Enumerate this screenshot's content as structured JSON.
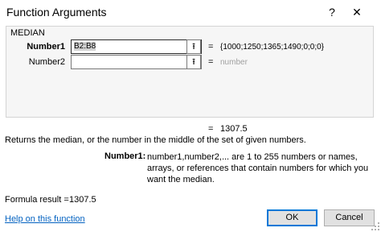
{
  "window": {
    "title": "Function Arguments",
    "help": "?",
    "close": "✕"
  },
  "function_name": "MEDIAN",
  "arguments": [
    {
      "label": "Number1",
      "value": "B2:B8",
      "collapse_icon": "⭱",
      "equals": "=",
      "evaluated": "{1000;1250;1365;1490;0;0;0}"
    },
    {
      "label": "Number2",
      "value": "",
      "collapse_icon": "⭱",
      "equals": "=",
      "evaluated": "number"
    }
  ],
  "result_preview": {
    "equals": "=",
    "value": "1307.5"
  },
  "description": "Returns the median, or the number in the middle of the set of given numbers.",
  "arg_help": {
    "label": "Number1:",
    "text": "number1,number2,... are 1 to 255 numbers or names, arrays, or references that contain numbers for which you want the median."
  },
  "formula_result": {
    "label": "Formula result =",
    "value": "1307.5"
  },
  "help_link": "Help on this function",
  "buttons": {
    "ok": "OK",
    "cancel": "Cancel"
  }
}
